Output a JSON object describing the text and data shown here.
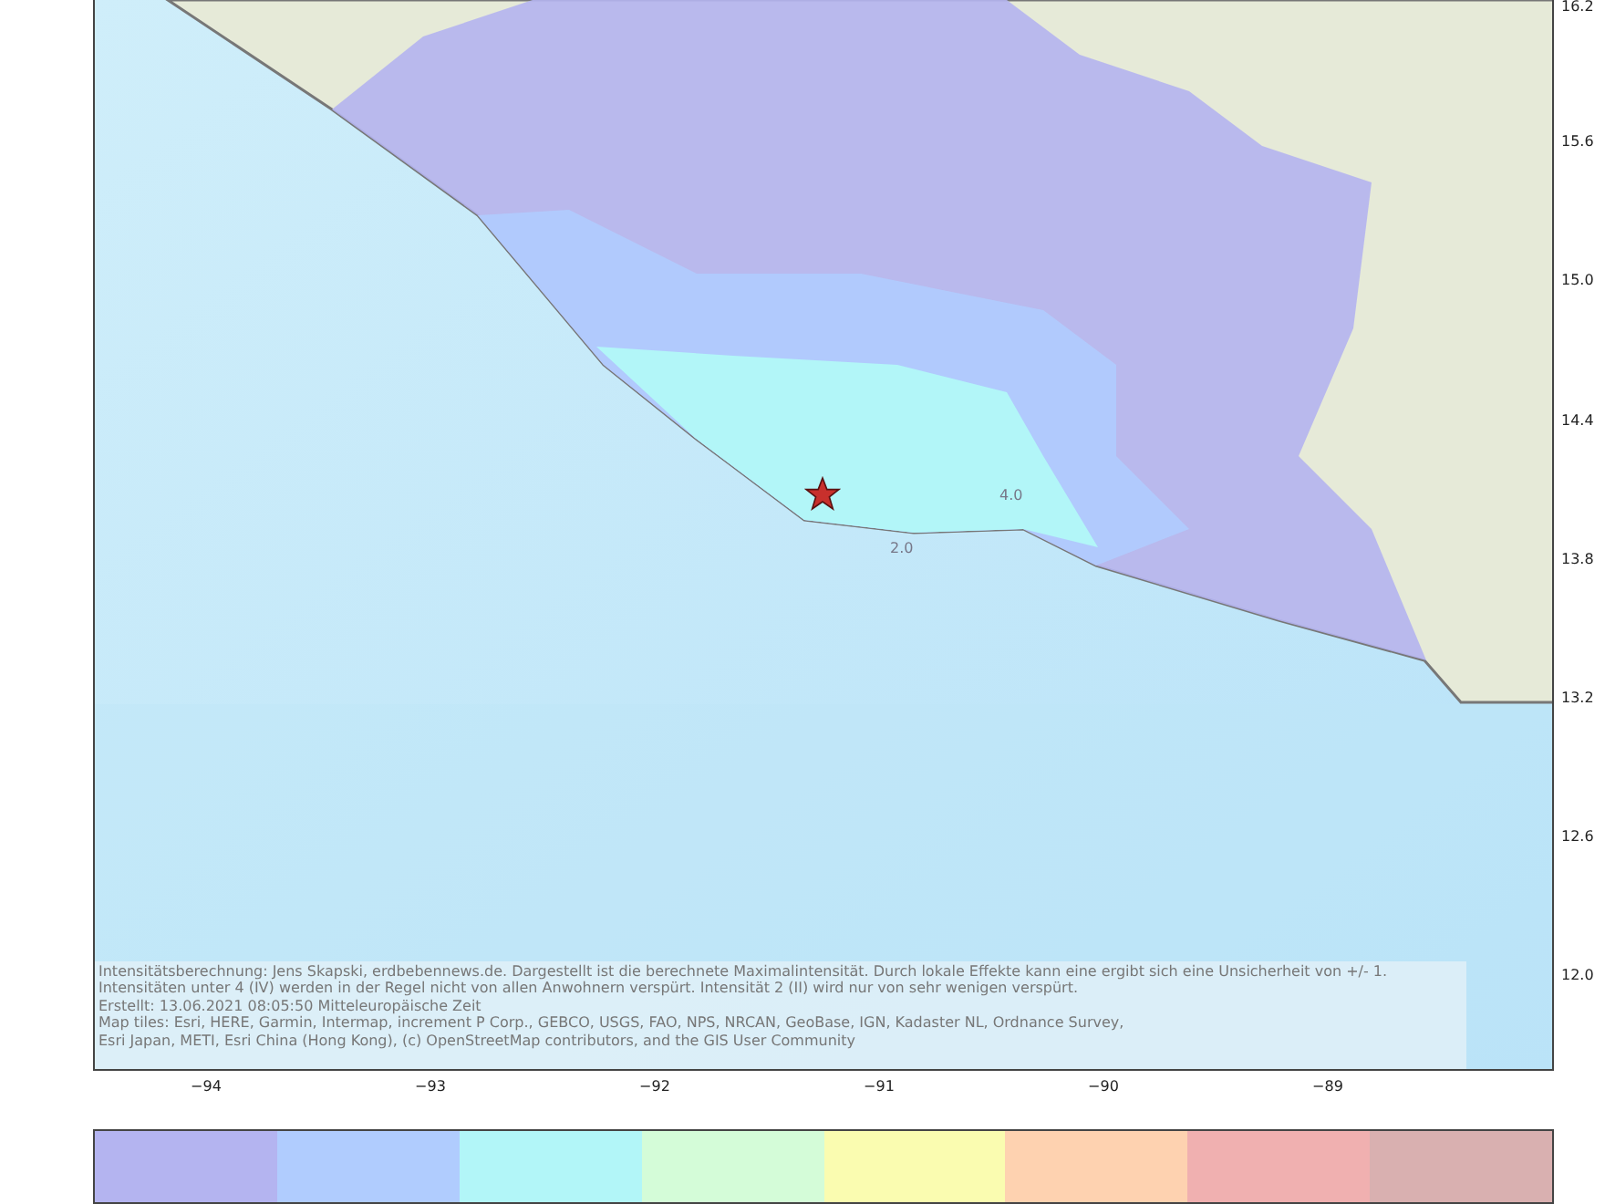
{
  "map": {
    "contour_labels": [
      "4.0",
      "2.0"
    ],
    "attribution": [
      "Intensitätsberechnung: Jens Skapski, erdbebennews.de. Dargestellt ist die berechnete Maximalintensität. Durch lokale Effekte kann eine ergibt sich eine Unsicherheit von +/- 1.",
      "Intensitäten unter 4 (IV) werden in der Regel nicht von allen Anwohnern verspürt. Intensität 2 (II) wird nur von sehr wenigen verspürt.",
      "Erstellt: 13.06.2021 08:05:50 Mitteleuropäische Zeit",
      "Map tiles: Esri, HERE, Garmin, Intermap, increment P Corp., GEBCO, USGS, FAO, NPS, NRCAN, GeoBase, IGN, Kadaster NL, Ordnance Survey,",
      "Esri Japan, METI, Esri China (Hong Kong), (c) OpenStreetMap contributors, and the GIS User Community"
    ],
    "x_ticks": [
      "−94",
      "−93",
      "−92",
      "−91",
      "−90",
      "−89"
    ],
    "y_ticks": [
      "16.2",
      "15.6",
      "15.0",
      "14.4",
      "13.8",
      "13.2",
      "12.6",
      "12.0"
    ]
  },
  "colorbar": {
    "segments": [
      {
        "color": "#b4b4f0"
      },
      {
        "color": "#b0ccfe"
      },
      {
        "color": "#b2f6f8"
      },
      {
        "color": "#d4fcd8"
      },
      {
        "color": "#fafcb0"
      },
      {
        "color": "#fed2b0"
      },
      {
        "color": "#f0b0b0"
      },
      {
        "color": "#d9b0b0"
      }
    ]
  }
}
